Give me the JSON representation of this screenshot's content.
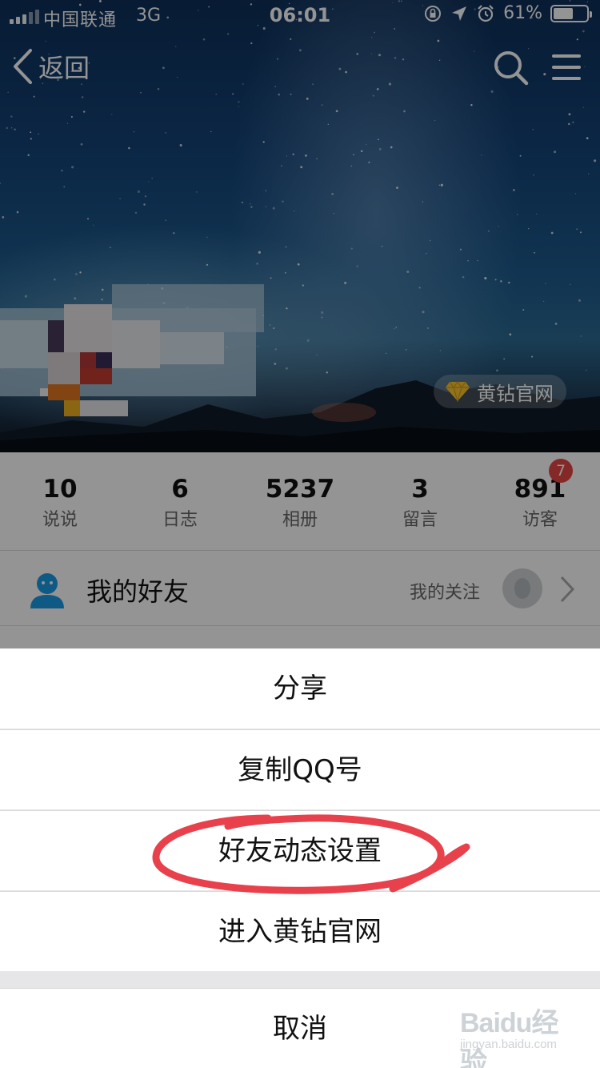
{
  "status_bar": {
    "carrier": "中国联通",
    "network": "3G",
    "time": "06:01",
    "battery_percent": "61%",
    "battery_level": 0.61
  },
  "nav": {
    "back_label": "返回",
    "icons": [
      "chevron-left-icon",
      "search-icon",
      "menu-icon"
    ]
  },
  "cover": {
    "vip_link_label": "黄钻官网",
    "vip_icon": "diamond-icon"
  },
  "stats": [
    {
      "value": "10",
      "label": "说说"
    },
    {
      "value": "6",
      "label": "日志"
    },
    {
      "value": "5237",
      "label": "相册"
    },
    {
      "value": "3",
      "label": "留言"
    },
    {
      "value": "891",
      "label": "访客"
    }
  ],
  "visitor_badge": "7",
  "friends_row": {
    "title": "我的好友",
    "follow_label": "我的关注"
  },
  "action_sheet": {
    "items": [
      {
        "label": "分享"
      },
      {
        "label": "复制QQ号"
      },
      {
        "label": "好友动态设置"
      },
      {
        "label": "进入黄钻官网"
      }
    ],
    "cancel_label": "取消"
  },
  "annotation_color": "#e8414c",
  "watermark": {
    "logo": "Baidu经验",
    "url": "jingyan.baidu.com"
  }
}
